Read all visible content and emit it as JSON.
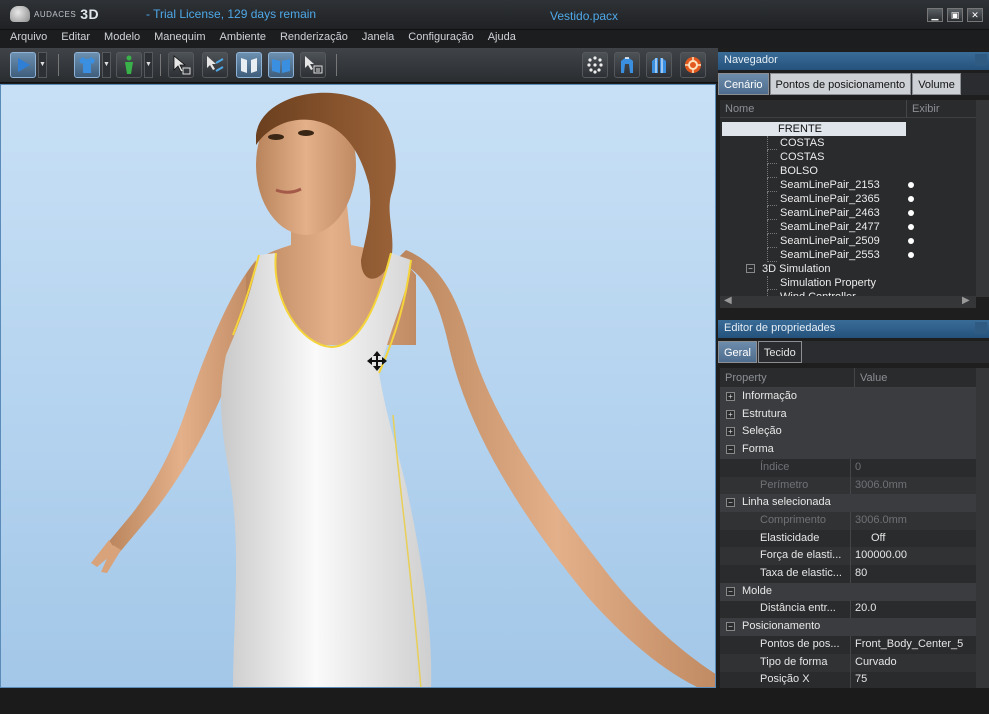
{
  "app": {
    "logo_small": "AUDACES",
    "logo_big": "3D",
    "license": "Trial License, 129 days remain",
    "document": "Vestido.pacx"
  },
  "window_controls": [
    "▁",
    "▣",
    "✕"
  ],
  "menu": [
    "Arquivo",
    "Editar",
    "Modelo",
    "Manequim",
    "Ambiente",
    "Renderização",
    "Janela",
    "Configuração",
    "Ajuda"
  ],
  "toolbar": {
    "icons": [
      "play-icon",
      "shirt-icon",
      "mannequin-icon",
      "select-arrow-icon",
      "sew-arrow-icon",
      "pattern-front-icon",
      "pattern-open-icon",
      "select-piece-icon",
      "grid-dots-icon",
      "mannequin-front-icon",
      "mannequin-side-icon",
      "render-icon"
    ]
  },
  "navigator": {
    "title": "Navegador",
    "tabs": [
      "Cenário",
      "Pontos de posicionamento",
      "Volume"
    ],
    "columns": {
      "name": "Nome",
      "show": "Exibir"
    },
    "items": [
      {
        "label": "FRENTE",
        "indent": 2,
        "selected": true,
        "dot": false
      },
      {
        "label": "COSTAS",
        "indent": 2,
        "selected": false,
        "dot": false
      },
      {
        "label": "COSTAS",
        "indent": 2,
        "selected": false,
        "dot": false
      },
      {
        "label": "BOLSO",
        "indent": 2,
        "selected": false,
        "dot": false
      },
      {
        "label": "SeamLinePair_2153",
        "indent": 2,
        "selected": false,
        "dot": true
      },
      {
        "label": "SeamLinePair_2365",
        "indent": 2,
        "selected": false,
        "dot": true
      },
      {
        "label": "SeamLinePair_2463",
        "indent": 2,
        "selected": false,
        "dot": true
      },
      {
        "label": "SeamLinePair_2477",
        "indent": 2,
        "selected": false,
        "dot": true
      },
      {
        "label": "SeamLinePair_2509",
        "indent": 2,
        "selected": false,
        "dot": true
      },
      {
        "label": "SeamLinePair_2553",
        "indent": 2,
        "selected": false,
        "dot": true
      },
      {
        "label": "3D Simulation",
        "indent": 1,
        "selected": false,
        "dot": false,
        "expander": "−"
      },
      {
        "label": "Simulation Property",
        "indent": 2,
        "selected": false,
        "dot": false
      },
      {
        "label": "Wind Controller",
        "indent": 2,
        "selected": false,
        "dot": false
      }
    ]
  },
  "properties": {
    "title": "Editor de propriedades",
    "tabs": [
      "Geral",
      "Tecido"
    ],
    "columns": {
      "property": "Property",
      "value": "Value"
    },
    "rows": [
      {
        "type": "cat",
        "name": "Informação",
        "exp": "+"
      },
      {
        "type": "cat",
        "name": "Estrutura",
        "exp": "+"
      },
      {
        "type": "cat",
        "name": "Seleção",
        "exp": "+"
      },
      {
        "type": "cat",
        "name": "Forma",
        "exp": "−"
      },
      {
        "type": "prop",
        "name": "Índice",
        "value": "0",
        "disabled": true
      },
      {
        "type": "prop",
        "name": "Perímetro",
        "value": "3006.0mm",
        "disabled": true
      },
      {
        "type": "cat",
        "name": "Linha selecionada",
        "exp": "−"
      },
      {
        "type": "prop",
        "name": "Comprimento",
        "value": "3006.0mm",
        "disabled": true
      },
      {
        "type": "prop",
        "name": "Elasticidade",
        "value": "Off",
        "disabled": false,
        "center": true
      },
      {
        "type": "prop",
        "name": "Força de elasti...",
        "value": "100000.00",
        "disabled": false
      },
      {
        "type": "prop",
        "name": "Taxa de elastic...",
        "value": "80",
        "disabled": false
      },
      {
        "type": "cat",
        "name": "Molde",
        "exp": "−"
      },
      {
        "type": "prop",
        "name": "Distância entr...",
        "value": "20.0",
        "disabled": false
      },
      {
        "type": "cat",
        "name": "Posicionamento",
        "exp": "−"
      },
      {
        "type": "prop",
        "name": "Pontos de pos...",
        "value": "Front_Body_Center_5",
        "disabled": false
      },
      {
        "type": "prop",
        "name": "Tipo de forma",
        "value": "Curvado",
        "disabled": false
      },
      {
        "type": "prop",
        "name": "Posição X",
        "value": "75",
        "disabled": false
      }
    ]
  },
  "colors": {
    "accent": "#4ea8e8",
    "panel_header": "#2f5f8c",
    "sky": "#b4d3ef",
    "dress": "#f2f2f2",
    "seam": "#f4d43a"
  }
}
